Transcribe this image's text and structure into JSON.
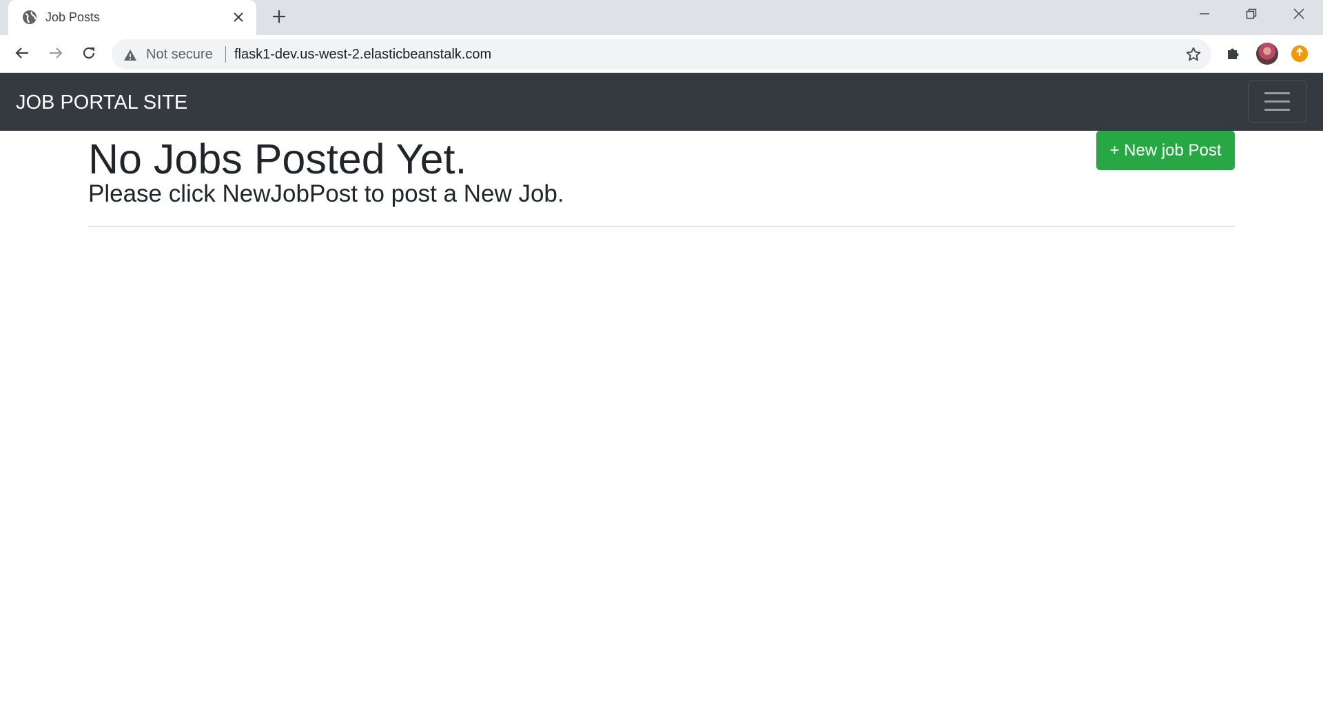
{
  "browser": {
    "tab": {
      "title": "Job Posts",
      "favicon": "globe-icon"
    },
    "address_bar": {
      "security_label": "Not secure",
      "url": "flask1-dev.us-west-2.elasticbeanstalk.com"
    },
    "colors": {
      "tabstrip": "#dee1e6",
      "update_badge": "#f29900"
    }
  },
  "site": {
    "navbar": {
      "brand": "JOB PORTAL SITE",
      "background": "#343a40"
    },
    "main": {
      "title": "No Jobs Posted Yet.",
      "subtitle": "Please click NewJobPost to post a New Job.",
      "new_post_button": "+ New job Post",
      "button_color": "#28a745"
    }
  }
}
